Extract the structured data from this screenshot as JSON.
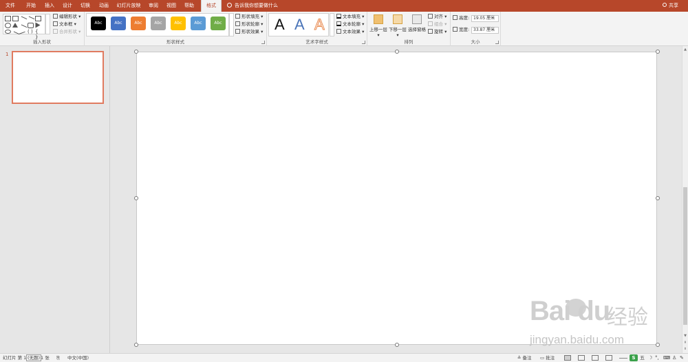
{
  "tabs": [
    "文件",
    "开始",
    "插入",
    "设计",
    "切换",
    "动画",
    "幻灯片放映",
    "审阅",
    "视图",
    "帮助",
    "格式"
  ],
  "active_tab": "格式",
  "tell_me": "告诉我你想要做什么",
  "share": "共享",
  "ribbon": {
    "insert_shapes": {
      "label": "插入形状",
      "edit_shape": "编辑形状",
      "text_box": "文本框",
      "merge_shapes": "合并形状"
    },
    "shape_styles": {
      "label": "形状样式",
      "preset_text": "Abc",
      "preset_colors": [
        "#000000",
        "#4472c4",
        "#ed7d31",
        "#a5a5a5",
        "#ffc000",
        "#5b9bd5",
        "#70ad47"
      ],
      "fill": "形状填充",
      "outline": "形状轮廓",
      "effects": "形状效果"
    },
    "wordart_styles": {
      "label": "艺术字样式",
      "sample": "A",
      "text_fill": "文本填充",
      "text_outline": "文本轮廓",
      "text_effects": "文本效果"
    },
    "arrange": {
      "label": "排列",
      "bring_forward": "上移一层",
      "send_backward": "下移一层",
      "selection_pane": "选择窗格",
      "align": "对齐",
      "group": "组合",
      "rotate": "旋转"
    },
    "size": {
      "label": "大小",
      "height_label": "高度:",
      "height_value": "19.05 厘米",
      "width_label": "宽度:",
      "width_value": "33.87 厘米"
    }
  },
  "thumbnail": {
    "slide_number": "1"
  },
  "status": {
    "slide_prefix": "幻灯片 第 1",
    "theme": "(无题)",
    "count": "1 张",
    "language": "中文(中国)",
    "notes": "备注",
    "comments": "批注"
  },
  "ime": {
    "s": "S",
    "wu": "五"
  },
  "watermark": {
    "logo": "Bai  du",
    "cn": "经验",
    "url": "jingyan.baidu.com"
  }
}
